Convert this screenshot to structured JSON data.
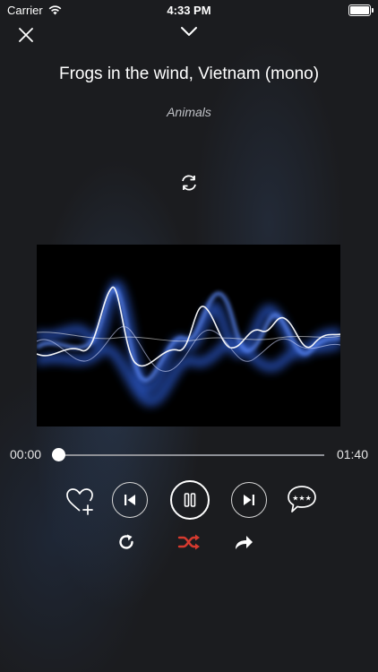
{
  "status_bar": {
    "carrier": "Carrier",
    "time": "4:33 PM",
    "icons": [
      "wifi-icon",
      "battery-icon"
    ]
  },
  "header": {
    "close_icon": "close-icon",
    "collapse_icon": "chevron-down-icon"
  },
  "track": {
    "title": "Frogs in the wind, Vietnam (mono)",
    "category": "Animals"
  },
  "sync_icon": "refresh-icon",
  "artwork": {
    "description_icon": "sound-waveform-artwork"
  },
  "progress": {
    "elapsed": "00:00",
    "total": "01:40",
    "fraction": 0.0
  },
  "controls": {
    "favorite": "heart-plus-icon",
    "previous": "skip-back-icon",
    "play_pause": "pause-icon",
    "next": "skip-forward-icon",
    "rate": "rating-bubble-icon",
    "repeat": "repeat-icon",
    "shuffle": "shuffle-icon",
    "share": "share-icon"
  },
  "colors": {
    "background": "#1b1c1f",
    "shuffle_active": "#d63a2f",
    "text_secondary": "#bfc1c6"
  }
}
